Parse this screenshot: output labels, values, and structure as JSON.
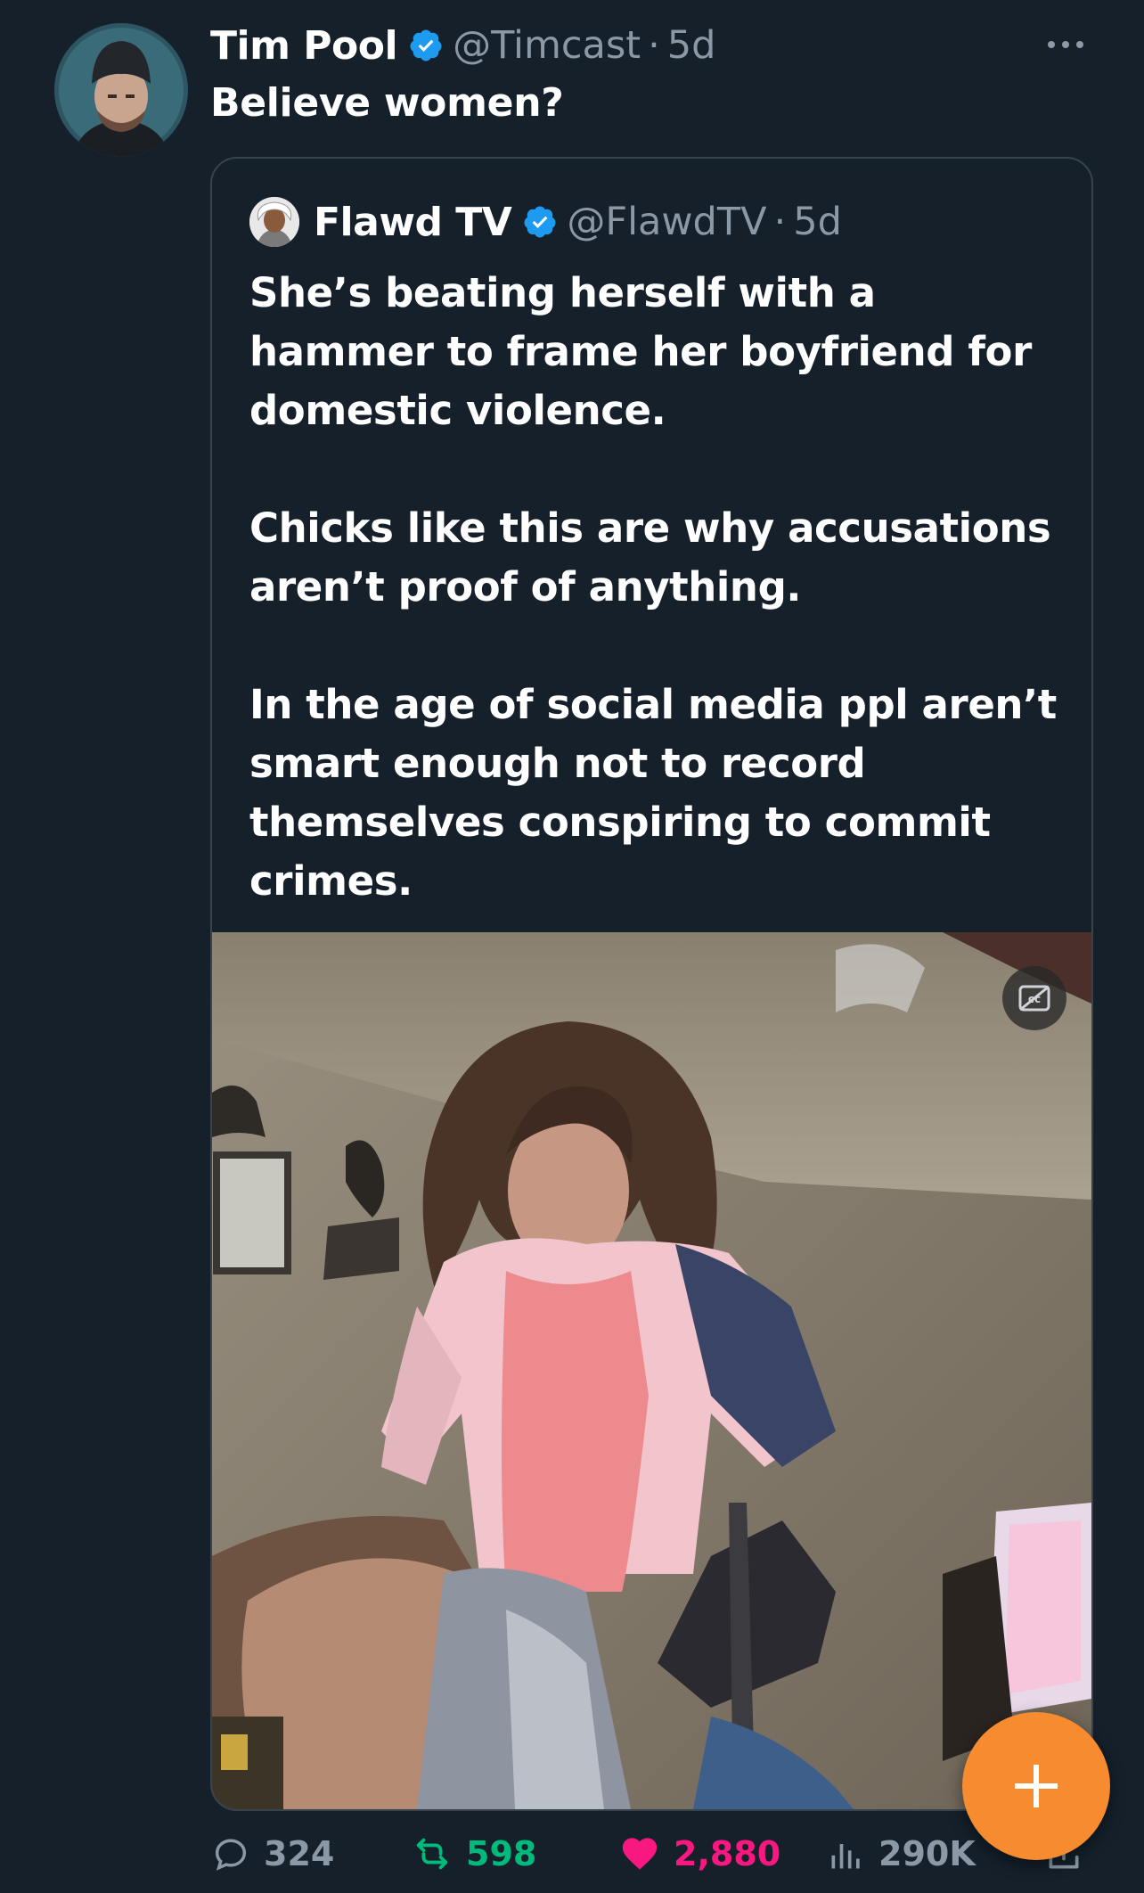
{
  "post": {
    "author_name": "Tim Pool",
    "handle": "@Timcast",
    "separator": "·",
    "time": "5d",
    "text": "Believe women?"
  },
  "quote": {
    "author_name": "Flawd TV",
    "handle": "@FlawdTV",
    "separator": "·",
    "time": "5d",
    "text": "She’s beating herself with a hammer to frame her boyfriend for domestic violence.\n\nChicks like this are why accusations aren’t proof of anything.\n\nIn the age of social media ppl aren’t smart enough not to record themselves conspiring to commit crimes."
  },
  "actions": {
    "replies": "324",
    "reposts": "598",
    "likes": "2,880",
    "views": "290K"
  },
  "colors": {
    "background": "#15202b",
    "muted_text": "#8b98a5",
    "verified": "#1d9bf0",
    "repost": "#00ba7c",
    "like": "#f91880",
    "fab": "#f68b2f"
  },
  "icons": [
    "verified-badge-icon",
    "more-icon",
    "closed-captions-icon",
    "reply-icon",
    "repost-icon",
    "like-icon",
    "views-icon",
    "share-icon",
    "compose-plus-icon"
  ]
}
